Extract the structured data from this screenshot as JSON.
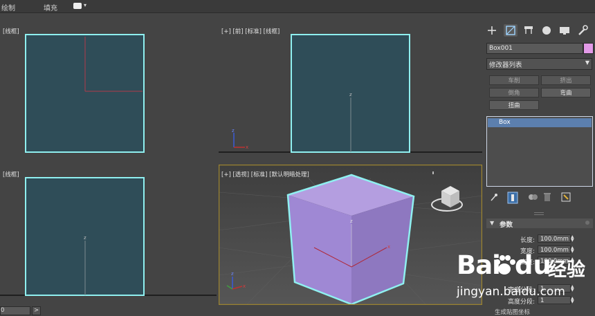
{
  "menu": {
    "draw": "绘制",
    "fill": "填充"
  },
  "viewports": {
    "top_left": {
      "label": "[线框]"
    },
    "front": {
      "label": "[+] [前] [标准] [线框]"
    },
    "bottom_left": {
      "label": "[线框]"
    },
    "perspective": {
      "label": "[+] [透视] [标准] [默认明暗处理]"
    }
  },
  "colors": {
    "wireframe_fill": "#2f4d58",
    "selection_outline": "#8ff0f0",
    "box_top": "#b49ee0",
    "box_front": "#9f88d4",
    "box_side": "#8e78c0",
    "active_viewport_border": "#9b8330",
    "object_color": "#e39ae7",
    "stack_selected": "#5c7fae"
  },
  "command_panel": {
    "tabs": [
      "create-icon",
      "modify-icon",
      "hierarchy-icon",
      "motion-icon",
      "display-icon",
      "utilities-icon"
    ],
    "object_name": "Box001",
    "modifier_list": "修改器列表",
    "buttons": {
      "mirror": "车削",
      "extrude": "挤出",
      "chamfer": "倒角",
      "bend": "弯曲",
      "twist": "扭曲"
    },
    "stack": [
      "Box"
    ],
    "rollout_title": "参数",
    "params": {
      "length": {
        "label": "长度:",
        "value": "100.0mm"
      },
      "width": {
        "label": "宽度:",
        "value": "100.0mm"
      },
      "height": {
        "label": "高度:",
        "value": "100.0mm"
      },
      "width_segs": {
        "label": "宽度分段:",
        "value": "1"
      },
      "height_segs": {
        "label": "高度分段:",
        "value": "1"
      }
    },
    "bottom_check": "生成贴图坐标"
  },
  "timeline": {
    "frame": "0",
    "next": ">"
  },
  "watermark": {
    "bai": "Bai",
    "du": "du",
    "jingyan": "经验",
    "url": "jingyan.baidu.com"
  }
}
